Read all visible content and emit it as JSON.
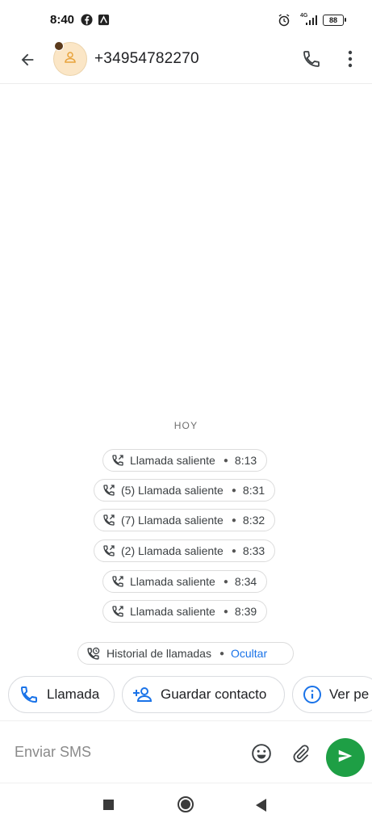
{
  "status_bar": {
    "time": "8:40",
    "network": "4G",
    "battery": "88",
    "icons": [
      "facebook-icon",
      "notification-icon",
      "alarm-icon",
      "signal-icon",
      "battery-icon"
    ]
  },
  "header": {
    "contact_number": "+34954782270",
    "icons": [
      "back-arrow-icon",
      "contact-avatar-icon",
      "phone-icon",
      "more-vert-icon"
    ]
  },
  "conversation": {
    "day_label": "HOY",
    "calls": [
      {
        "label": "Llamada saliente",
        "time": "8:13"
      },
      {
        "label": "(5) Llamada saliente",
        "time": "8:31"
      },
      {
        "label": "(7) Llamada saliente",
        "time": "8:32"
      },
      {
        "label": "(2) Llamada saliente",
        "time": "8:33"
      },
      {
        "label": "Llamada saliente",
        "time": "8:34"
      },
      {
        "label": "Llamada saliente",
        "time": "8:39"
      }
    ],
    "history": {
      "label": "Historial de llamadas",
      "action": "Ocultar"
    }
  },
  "suggestions": [
    {
      "label": "Llamada",
      "icon": "phone-icon"
    },
    {
      "label": "Guardar contacto",
      "icon": "add-person-icon"
    },
    {
      "label": "Ver pe",
      "icon": "info-icon"
    }
  ],
  "compose": {
    "placeholder": "Enviar SMS",
    "icons": [
      "emoji-icon",
      "attach-icon",
      "send-icon"
    ]
  },
  "colors": {
    "accent": "#1a73e8",
    "send": "#1e9f45",
    "avatar_bg": "#fbe6c6",
    "avatar_fg": "#e8a33c"
  }
}
